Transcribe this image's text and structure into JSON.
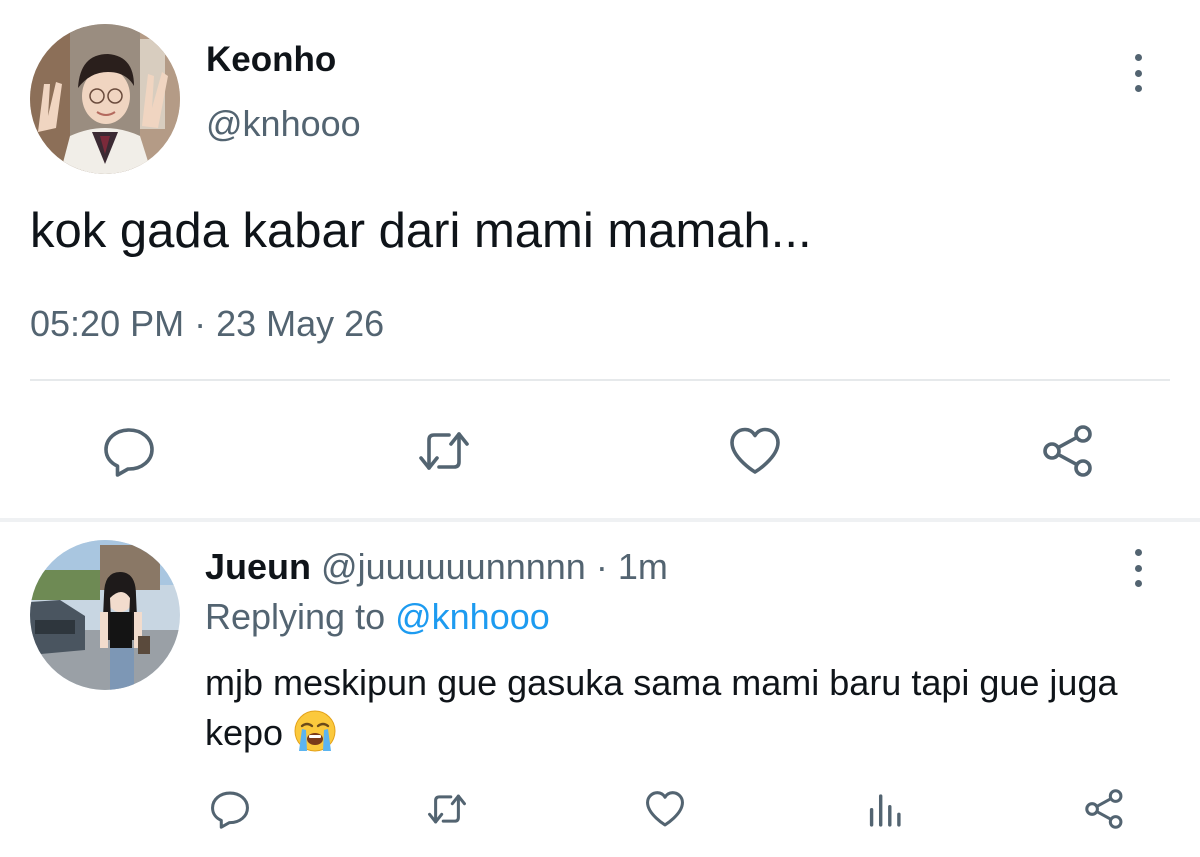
{
  "main_tweet": {
    "display_name": "Keonho",
    "handle": "@knhooo",
    "text": "kok gada kabar dari mami mamah...",
    "time": "05:20 PM",
    "separator": " · ",
    "date": "23 May 26",
    "actions": [
      "reply-icon",
      "retweet-icon",
      "like-icon",
      "share-icon"
    ]
  },
  "reply": {
    "display_name": "Jueun",
    "handle": "@juuuuuunnnnn",
    "separator": " · ",
    "time": "1m",
    "replying_prefix": "Replying to ",
    "replying_handle": "@knhooo",
    "text": "mjb meskipun gue gasuka sama mami baru tapi gue juga kepo",
    "emoji": "loudly-crying-face",
    "actions": [
      "reply-icon",
      "retweet-icon",
      "like-icon",
      "analytics-icon",
      "share-icon"
    ]
  },
  "colors": {
    "primary_text": "#0f1419",
    "secondary_text": "#536471",
    "link": "#1d9bf0",
    "divider": "#e6e9eb"
  }
}
